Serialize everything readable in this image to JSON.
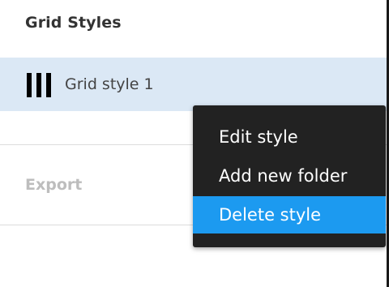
{
  "panel": {
    "section_title": "Grid Styles",
    "style_item": {
      "icon": "layout-grid-columns-icon",
      "label": "Grid style 1",
      "selected": true
    },
    "export_label": "Export"
  },
  "context_menu": {
    "items": [
      {
        "label": "Edit style",
        "highlighted": false
      },
      {
        "label": "Add new folder",
        "highlighted": false
      },
      {
        "label": "Delete style",
        "highlighted": true
      }
    ],
    "background": "#222222",
    "highlight_color": "#1c9af0"
  },
  "colors": {
    "selected_row": "#dbe8f5",
    "disabled_text": "#bdbdbd"
  }
}
